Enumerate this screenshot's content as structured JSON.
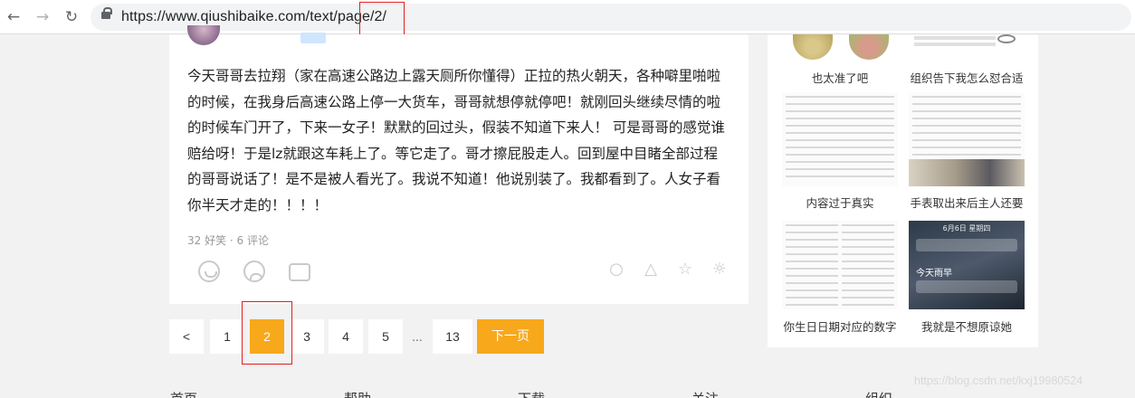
{
  "browser": {
    "url": "https://www.qiushibaike.com/text/page/2/",
    "back_icon": "arrow-left-icon",
    "forward_icon": "arrow-right-icon",
    "reload_icon": "reload-icon"
  },
  "article": {
    "content": "今天哥哥去拉翔（家在高速公路边上露天厕所你懂得）正拉的热火朝天，各种噼里啪啦的时候，在我身后高速公路上停一大货车，哥哥就想停就停吧！就刚回头继续尽情的啦的时候车门开了，下来一女子！默默的回过头，假装不知道下来人！ 可是哥哥的感觉谁赔给呀！于是lz就跟这车耗上了。等它走了。哥才擦屁股走人。回到屋中目睹全部过程的哥哥说话了！是不是被人看光了。我说不知道！他说别装了。我都看到了。人女子看你半天才走的！！！！",
    "meta": "32 好笑 · 6 评论"
  },
  "pagination": {
    "prev": "<",
    "pages": [
      "1",
      "2",
      "3",
      "4",
      "5"
    ],
    "ellipsis": "...",
    "last": "13",
    "next": "下一页",
    "current": "2"
  },
  "sidebar": {
    "items": [
      {
        "caption": "也太准了吧"
      },
      {
        "caption": "组织告下我怎么怼合适"
      },
      {
        "caption": "内容过于真实"
      },
      {
        "caption": "手表取出来后主人还要"
      },
      {
        "caption": "你生日日期对应的数字"
      },
      {
        "caption": "我就是不想原谅她"
      }
    ],
    "thumb6_clock": "6月6日 星期四",
    "thumb6_tag": "今天雨早"
  },
  "footer": {
    "links": [
      "首页",
      "帮助",
      "下载",
      "关注",
      "组织"
    ],
    "watermark": "https://blog.csdn.net/kxj19980524"
  },
  "colors": {
    "accent": "#f8a81b",
    "highlight_box": "#e02020"
  }
}
